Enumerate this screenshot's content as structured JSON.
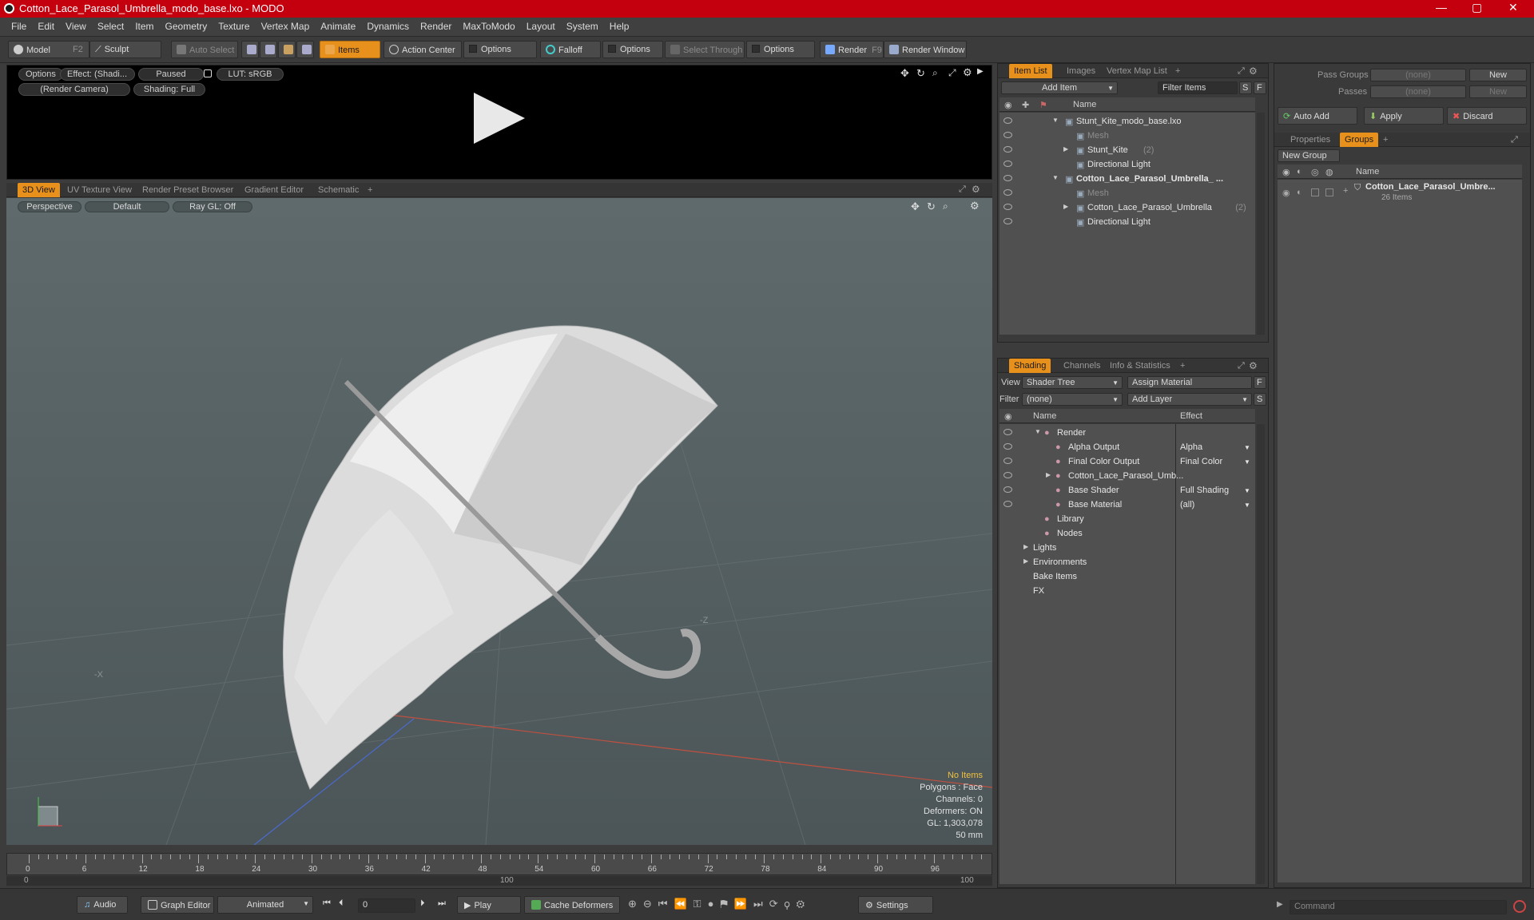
{
  "window": {
    "title": "Cotton_Lace_Parasol_Umbrella_modo_base.lxo - MODO",
    "min": "—",
    "max": "▢",
    "close": "✕"
  },
  "menu": [
    "File",
    "Edit",
    "View",
    "Select",
    "Item",
    "Geometry",
    "Texture",
    "Vertex Map",
    "Animate",
    "Dynamics",
    "Render",
    "MaxToModo",
    "Layout",
    "System",
    "Help"
  ],
  "toolbar": {
    "model": "Model",
    "model_key": "F2",
    "sculpt": "Sculpt",
    "auto_select": "Auto Select",
    "items": "Items",
    "action_center": "Action Center",
    "options1": "Options",
    "falloff": "Falloff",
    "options2": "Options",
    "select_through": "Select Through",
    "options3": "Options",
    "render": "Render",
    "render_key": "F9",
    "render_window": "Render Window"
  },
  "preview": {
    "options": "Options",
    "effect": "Effect: (Shadi...",
    "paused": "Paused",
    "lut": "LUT: sRGB",
    "camera": "(Render Camera)",
    "shading": "Shading: Full"
  },
  "view_tabs": [
    "3D View",
    "UV Texture View",
    "Render Preset Browser",
    "Gradient Editor",
    "Schematic",
    "+"
  ],
  "viewport": {
    "perspective": "Perspective",
    "default": "Default",
    "raygl": "Ray GL: Off",
    "axis_x": "-X",
    "axis_z": "-Z",
    "stats": {
      "items": "No Items",
      "polygons": "Polygons : Face",
      "channels": "Channels: 0",
      "deformers": "Deformers: ON",
      "gl": "GL: 1,303,078",
      "size": "50 mm"
    }
  },
  "timeline": {
    "ticks": [
      "0",
      "6",
      "12",
      "18",
      "24",
      "30",
      "36",
      "42",
      "48",
      "54",
      "60",
      "66",
      "72",
      "78",
      "84",
      "90",
      "96"
    ],
    "sub": [
      "0",
      "100",
      "100"
    ]
  },
  "bottom": {
    "audio": "Audio",
    "graph_editor": "Graph Editor",
    "animated": "Animated",
    "frame": "0",
    "play": "Play",
    "cache": "Cache Deformers",
    "settings": "Settings",
    "command_placeholder": "Command"
  },
  "item_list": {
    "tabs": [
      "Item List",
      "Images",
      "Vertex Map List",
      "+"
    ],
    "add_item": "Add Item",
    "filter": "Filter Items",
    "s": "S",
    "f": "F",
    "col_name": "Name",
    "rows": [
      {
        "label": "Stunt_Kite_modo_base.lxo",
        "indent": 0,
        "bold": false,
        "dim": false,
        "arrow": "▼"
      },
      {
        "label": "Mesh",
        "indent": 1,
        "bold": false,
        "dim": true,
        "arrow": ""
      },
      {
        "label": "Stunt_Kite",
        "count": "(2)",
        "indent": 1,
        "bold": false,
        "dim": false,
        "arrow": "▶"
      },
      {
        "label": "Directional Light",
        "indent": 1,
        "bold": false,
        "dim": false,
        "arrow": ""
      },
      {
        "label": "Cotton_Lace_Parasol_Umbrella_ ...",
        "indent": 0,
        "bold": true,
        "dim": false,
        "arrow": "▼"
      },
      {
        "label": "Mesh",
        "indent": 1,
        "bold": false,
        "dim": true,
        "arrow": ""
      },
      {
        "label": "Cotton_Lace_Parasol_Umbrella",
        "count": "(2)",
        "indent": 1,
        "bold": false,
        "dim": false,
        "arrow": "▶"
      },
      {
        "label": "Directional Light",
        "indent": 1,
        "bold": false,
        "dim": false,
        "arrow": ""
      }
    ]
  },
  "shading": {
    "tabs": [
      "Shading",
      "Channels",
      "Info & Statistics",
      "+"
    ],
    "view_label": "View",
    "view_value": "Shader Tree",
    "assign": "Assign Material",
    "filter_label": "Filter",
    "filter_value": "(none)",
    "add_layer": "Add Layer",
    "f": "F",
    "s": "S",
    "col_name": "Name",
    "col_effect": "Effect",
    "rows": [
      {
        "label": "Render",
        "effect": "",
        "indent": 0,
        "arrow": "▼",
        "eye": true
      },
      {
        "label": "Alpha Output",
        "effect": "Alpha",
        "indent": 1,
        "arrow": "",
        "eye": true
      },
      {
        "label": "Final Color Output",
        "effect": "Final Color",
        "indent": 1,
        "arrow": "",
        "eye": true
      },
      {
        "label": "Cotton_Lace_Parasol_Umb...",
        "effect": "",
        "indent": 1,
        "arrow": "▶",
        "eye": true
      },
      {
        "label": "Base Shader",
        "effect": "Full Shading",
        "indent": 1,
        "arrow": "",
        "eye": true
      },
      {
        "label": "Base Material",
        "effect": "(all)",
        "indent": 1,
        "arrow": "",
        "eye": true
      },
      {
        "label": "Library",
        "effect": "",
        "indent": 0,
        "arrow": "",
        "eye": false
      },
      {
        "label": "Nodes",
        "effect": "",
        "indent": 0,
        "arrow": "",
        "eye": false
      },
      {
        "label": "Lights",
        "effect": "",
        "indent": -1,
        "arrow": "▶",
        "eye": false
      },
      {
        "label": "Environments",
        "effect": "",
        "indent": -1,
        "arrow": "▶",
        "eye": false
      },
      {
        "label": "Bake Items",
        "effect": "",
        "indent": -1,
        "arrow": "",
        "eye": false
      },
      {
        "label": "FX",
        "effect": "",
        "indent": -1,
        "arrow": "",
        "eye": false
      }
    ]
  },
  "groups": {
    "pass_groups": "Pass Groups",
    "passes": "Passes",
    "none1": "(none)",
    "none2": "(none)",
    "new1": "New",
    "new2": "New",
    "auto_add": "Auto Add",
    "apply": "Apply",
    "discard": "Discard",
    "tabs": [
      "Properties",
      "Groups",
      "+"
    ],
    "new_group": "New Group",
    "col_name": "Name",
    "item": "Cotton_Lace_Parasol_Umbre...",
    "item_count": "26 Items"
  }
}
